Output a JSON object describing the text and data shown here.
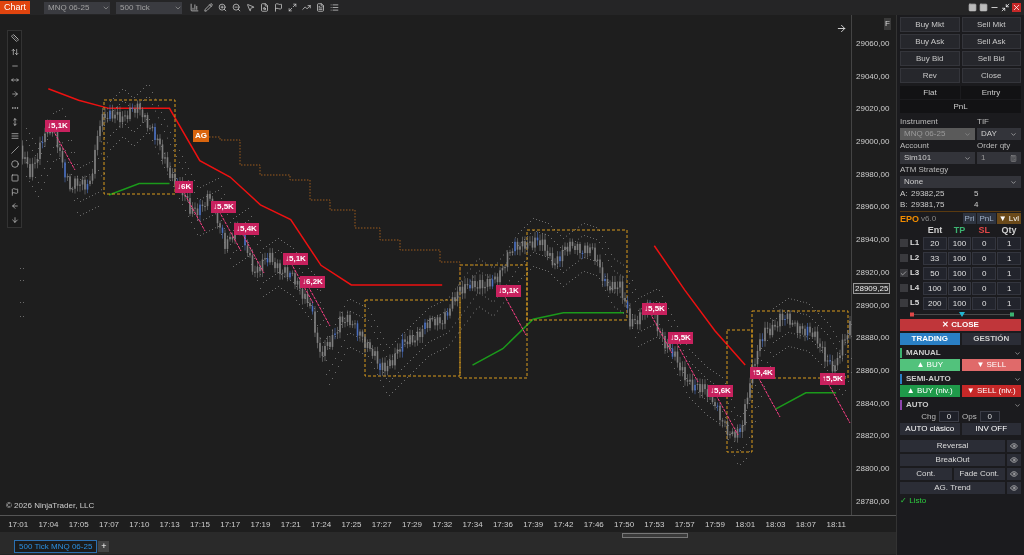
{
  "toolbar": {
    "title": "Chart",
    "instrument": "MNQ 06-25",
    "period": "500 Tick"
  },
  "chart": {
    "corner_label": "F",
    "copyright": "© 2026 NinjaTrader, LLC",
    "tag": "AG",
    "current_price": "28909,25",
    "signals": [
      "↓5,1K",
      "↓6K",
      "↓5,5K",
      "↓5,4K",
      "↓5,1K",
      "↓6,2K",
      "↓5,1K",
      "↓5,5K",
      "↓5,5K",
      "↓5,6K",
      "↑5,4K",
      "↑5,5K"
    ],
    "chart_data": {
      "type": "line",
      "categories": [
        "17:01",
        "17:04",
        "17:05",
        "17:07",
        "17:10",
        "17:13",
        "17:15",
        "17:17",
        "17:19",
        "17:21",
        "17:24",
        "17:25",
        "17:27",
        "17:29",
        "17:32",
        "17:34",
        "17:36",
        "17:39",
        "17:42",
        "17:46",
        "17:50",
        "17:53",
        "17:57",
        "17:59",
        "18:01",
        "18:03",
        "18:07",
        "18:11"
      ],
      "ylim": [
        28771.3,
        29077.1
      ],
      "yticks": [
        {
          "value": 29060,
          "label": "29060,00"
        },
        {
          "value": 29040,
          "label": "29040,00"
        },
        {
          "value": 29020,
          "label": "29020,00"
        },
        {
          "value": 29000,
          "label": "29000,00"
        },
        {
          "value": 28980,
          "label": "28980,00"
        },
        {
          "value": 28960,
          "label": "28960,00"
        },
        {
          "value": 28940,
          "label": "28940,00"
        },
        {
          "value": 28920,
          "label": "28920,00"
        },
        {
          "value": 28900,
          "label": "28900,00"
        },
        {
          "value": 28880,
          "label": "28880,00"
        },
        {
          "value": 28860,
          "label": "28860,00"
        },
        {
          "value": 28840,
          "label": "28840,00"
        },
        {
          "value": 28820,
          "label": "28820,00"
        },
        {
          "value": 28800,
          "label": "28800,00"
        },
        {
          "value": 28780,
          "label": "28780,00"
        }
      ],
      "series": [
        {
          "color": "#ee1111",
          "values": [
            null,
            29032,
            29025,
            29020,
            29020,
            29020,
            28988,
            28978,
            28961,
            28952,
            28924,
            28912,
            28912,
            28912,
            28912,
            null,
            null,
            null,
            null,
            null,
            null,
            28936,
            28909,
            28884,
            28863,
            null,
            null,
            null
          ]
        },
        {
          "color": "#1b9a1b",
          "values": [
            null,
            null,
            null,
            28967,
            28974,
            28974,
            null,
            null,
            null,
            null,
            null,
            null,
            null,
            null,
            null,
            28863,
            28873,
            28891,
            28895,
            28895,
            28895,
            null,
            null,
            null,
            null,
            28836,
            28846,
            28846
          ]
        }
      ]
    }
  },
  "order_buttons": [
    "Buy Mkt",
    "Sell Mkt",
    "Buy Ask",
    "Sell Ask",
    "Buy Bid",
    "Sell Bid",
    "Rev",
    "Close"
  ],
  "position": {
    "flat": "Flat",
    "entry": "Entry",
    "pnl": "PnL"
  },
  "form": {
    "instrument_label": "Instrument",
    "instrument": "MNQ 06-25",
    "instrument_disabled": true,
    "tif_label": "TIF",
    "tif": "DAY",
    "account_label": "Account",
    "account": "Sim101",
    "qty_label": "Order qty",
    "qty": "1",
    "atm_label": "ATM Strategy",
    "atm": "None"
  },
  "quotes": [
    {
      "label": "A:",
      "price": "29382,25",
      "size": "5"
    },
    {
      "label": "B:",
      "price": "29381,75",
      "size": "4"
    }
  ],
  "epo": {
    "title": "EPO",
    "version": "v6.0",
    "tabs": [
      {
        "label": "Pri",
        "selected": false
      },
      {
        "label": "PnL",
        "selected": false
      },
      {
        "label": "▼ Lvl",
        "selected": true
      }
    ],
    "columns": [
      {
        "label": "Ent",
        "color": "#d0d0d0"
      },
      {
        "label": "TP",
        "color": "#3cb371"
      },
      {
        "label": "SL",
        "color": "#e04848"
      },
      {
        "label": "Qty",
        "color": "#d0d0d0"
      }
    ],
    "levels": [
      {
        "label": "L1",
        "checked": false,
        "values": [
          "20",
          "100",
          "0",
          "1"
        ]
      },
      {
        "label": "L2",
        "checked": false,
        "values": [
          "33",
          "100",
          "0",
          "1"
        ]
      },
      {
        "label": "L3",
        "checked": true,
        "values": [
          "50",
          "100",
          "0",
          "1"
        ]
      },
      {
        "label": "L4",
        "checked": false,
        "values": [
          "100",
          "100",
          "0",
          "1"
        ]
      },
      {
        "label": "L5",
        "checked": false,
        "values": [
          "200",
          "100",
          "0",
          "1"
        ]
      }
    ],
    "close_button": "✕ CLOSE",
    "mode_tabs": [
      {
        "label": "TRADING",
        "selected": true
      },
      {
        "label": "GESTIÓN",
        "selected": false
      }
    ],
    "sections": [
      {
        "kind": "buttons",
        "title": "MANUAL",
        "color": "#3cb371",
        "buttons": [
          {
            "label": "▲ BUY",
            "color": "#52c27c"
          },
          {
            "label": "▼ SELL",
            "color": "#e06a6a"
          }
        ]
      },
      {
        "kind": "buttons",
        "title": "SEMI-AUTO",
        "color": "#2a7fc4",
        "buttons": [
          {
            "label": "▲ BUY (niv.)",
            "color": "#1f9a4a"
          },
          {
            "label": "▼ SELL (niv.)",
            "color": "#c62828"
          }
        ]
      },
      {
        "kind": "auto",
        "title": "AUTO",
        "color": "#8e44ad",
        "fields": [
          {
            "label": "Chg",
            "value": "0"
          },
          {
            "label": "Ops",
            "value": "0"
          }
        ],
        "buttons": [
          {
            "label": "AUTO clásico",
            "color": "#2b2d36"
          },
          {
            "label": "INV OFF",
            "color": "#2b2d36"
          }
        ]
      }
    ],
    "strategies": [
      {
        "buttons": [
          "Reversal"
        ]
      },
      {
        "buttons": [
          "BreakOut"
        ]
      },
      {
        "buttons": [
          "Cont.",
          "Fade Cont."
        ]
      },
      {
        "buttons": [
          "AG. Trend"
        ]
      }
    ],
    "status": "✓ Listo"
  },
  "bottom_tabs": [
    {
      "label": "500 Tick MNQ 06-25",
      "selected": true
    }
  ],
  "add_tab": "+"
}
